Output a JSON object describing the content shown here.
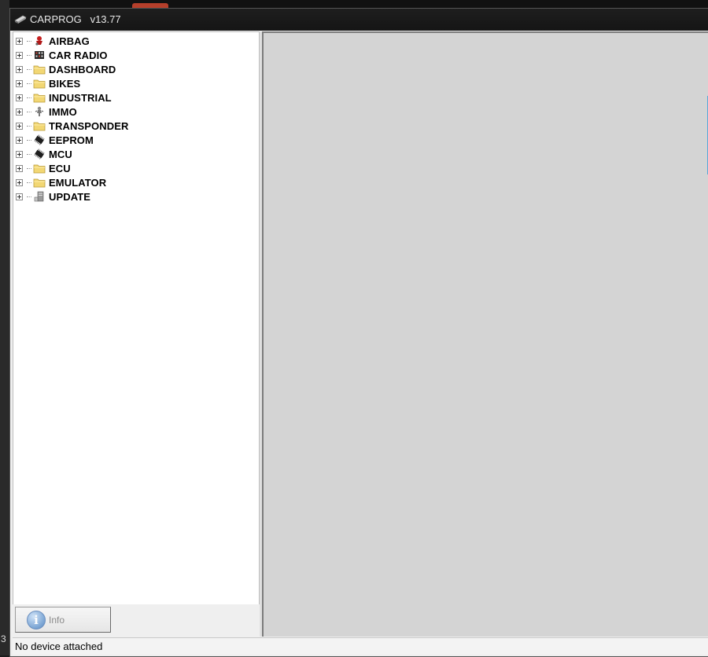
{
  "window": {
    "title": "CARPROG   v13.77"
  },
  "tree": {
    "items": [
      {
        "label": "AIRBAG",
        "icon": "airbag-icon"
      },
      {
        "label": "CAR RADIO",
        "icon": "car-radio-icon"
      },
      {
        "label": "DASHBOARD",
        "icon": "folder-icon"
      },
      {
        "label": "BIKES",
        "icon": "folder-icon"
      },
      {
        "label": "INDUSTRIAL",
        "icon": "folder-icon"
      },
      {
        "label": "IMMO",
        "icon": "immo-icon"
      },
      {
        "label": "TRANSPONDER",
        "icon": "folder-icon"
      },
      {
        "label": "EEPROM",
        "icon": "chip-icon"
      },
      {
        "label": "MCU",
        "icon": "chip-icon"
      },
      {
        "label": "ECU",
        "icon": "folder-icon"
      },
      {
        "label": "EMULATOR",
        "icon": "folder-icon"
      },
      {
        "label": "UPDATE",
        "icon": "update-icon"
      }
    ]
  },
  "info_button": {
    "label": "Info",
    "icon": "info-icon"
  },
  "status": {
    "text": "No device attached"
  },
  "desktop": {
    "corner_text": "3"
  },
  "colors": {
    "titlebar": "#1a1a1a",
    "tree_background": "#ffffff",
    "content_background": "#d4d4d4",
    "accent_blue": "#5aa7d8"
  }
}
